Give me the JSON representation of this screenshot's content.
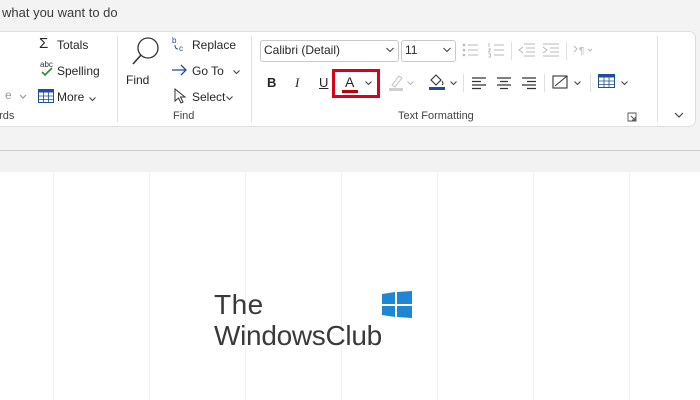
{
  "tell_me": {
    "text": "what you want to do"
  },
  "ribbon": {
    "records_group": {
      "label": "ords",
      "totals": "Totals",
      "spelling": "Spelling",
      "more": "More"
    },
    "find_group": {
      "label": "Find",
      "find": "Find",
      "replace": "Replace",
      "goto": "Go To",
      "select": "Select"
    },
    "text_group": {
      "label": "Text Formatting",
      "font_name": "Calibri (Detail)",
      "font_size": "11",
      "bold": "B",
      "italic": "I",
      "underline": "U",
      "font_color_glyph": "A"
    }
  },
  "colors": {
    "font_color_bar": "#c00000",
    "highlight_box": "#d9001a",
    "windows_logo": "#1f86d4"
  },
  "watermark": {
    "line1": "The",
    "line2": "WindowsClub"
  }
}
